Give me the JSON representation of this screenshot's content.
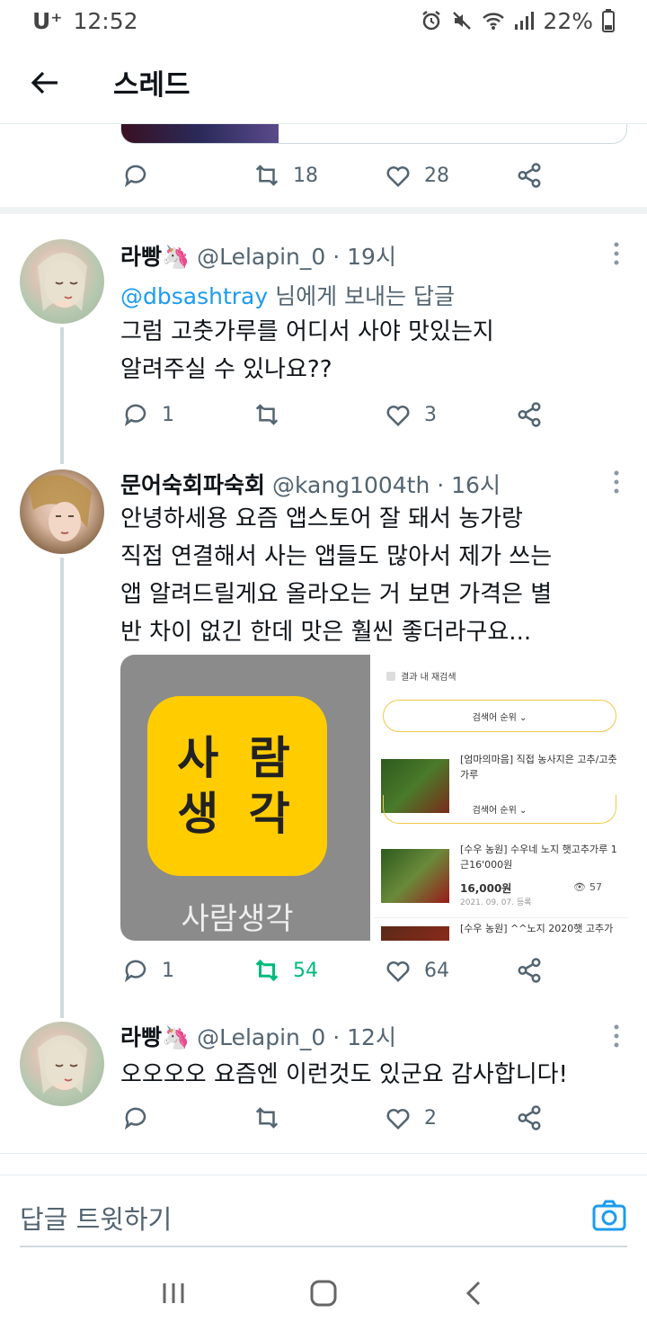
{
  "status_bar": {
    "carrier": "U⁺",
    "time": "12:52",
    "battery": "22%"
  },
  "header": {
    "title": "스레드"
  },
  "previous_tweet": {
    "retweets": "18",
    "likes": "28"
  },
  "tweets": [
    {
      "name": "라빵🦄",
      "handle": "@Lelapin_0 · 19시",
      "reply_prefix": "@dbsashtray",
      "reply_suffix": " 님에게 보내는 답글",
      "text_lines": [
        "그럼 고춧가루를 어디서 사야 맛있는지",
        "알려주실 수 있나요??"
      ],
      "replies": "1",
      "retweets": "",
      "likes": "3"
    },
    {
      "name": "문어숙회파숙회",
      "handle": "@kang1004th · 16시",
      "text_lines": [
        "안녕하세용 요즘 앱스토어 잘 돼서 농가랑",
        "직접 연결해서 사는 앱들도 많아서 제가 쓰는",
        "앱 알려드릴게요 올라오는 거 보면 가격은 별",
        "반 차이 없긴 한데 맛은 훨씬 좋더라구요..."
      ],
      "replies": "1",
      "retweets": "54",
      "likes": "64",
      "media": {
        "app_icon_line1": "사 람",
        "app_icon_line2": "생 각",
        "app_name": "사람생각",
        "panel_check": "결과 내 재검색",
        "sort_label": "검색어 순위 ⌄",
        "product1": "[엄마의마음] 직접 농사지은 고추/고춧가루",
        "product2": "[수우 농원] 수우네 노지 햇고추가루 1근16'000원",
        "product2_price": "16,000원",
        "product2_date": "2021. 09. 07. 등록",
        "product2_views": "57",
        "product3": "[수우 농원] ^^노지 2020햇 고추가"
      }
    },
    {
      "name": "라빵🦄",
      "handle": "@Lelapin_0 · 12시",
      "text_lines": [
        "오오오오 요즘엔 이런것도 있군요 감사합니다!"
      ],
      "replies": "",
      "retweets": "",
      "likes": "2"
    }
  ],
  "compose": {
    "placeholder": "답글 트윗하기"
  },
  "colors": {
    "accent": "#1d9bf0",
    "retweet_active": "#00ba7c",
    "muted": "#536471"
  }
}
